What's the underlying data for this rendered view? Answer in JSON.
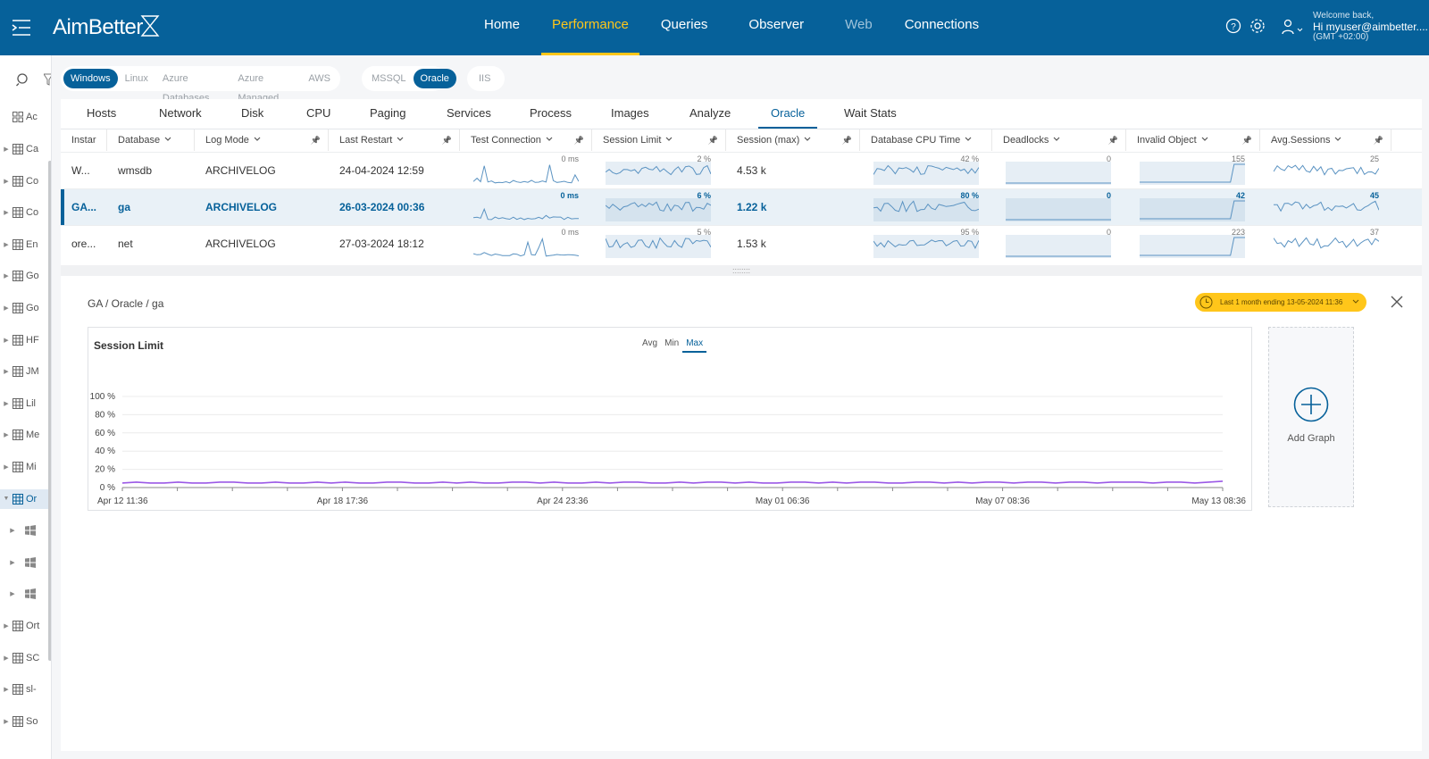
{
  "app": {
    "logo": "AimBetter"
  },
  "nav": {
    "items": [
      {
        "label": "Home",
        "state": "normal"
      },
      {
        "label": "Performance",
        "state": "active"
      },
      {
        "label": "Queries",
        "state": "normal"
      },
      {
        "label": "Observer",
        "state": "normal"
      },
      {
        "label": "Web",
        "state": "dim"
      },
      {
        "label": "Connections",
        "state": "normal"
      }
    ]
  },
  "user": {
    "welcome": "Welcome back,",
    "name": "Hi myuser@aimbetter....",
    "tz": "(GMT +02:00)"
  },
  "rail": {
    "top_label": "Ac",
    "items": [
      "Ca",
      "Co",
      "Co",
      "En",
      "Go",
      "Go",
      "HF",
      "JM",
      "Lil",
      "Me",
      "Mi",
      "Or",
      "",
      "",
      "",
      "Ort",
      "SC",
      "sl-",
      "So"
    ],
    "selected_index": 11
  },
  "filters": {
    "os": [
      "Windows",
      "Linux",
      "Azure Databases",
      "Azure Managed",
      "AWS"
    ],
    "os_active": 0,
    "db": [
      "MSSQL",
      "Oracle"
    ],
    "db_active": 1,
    "web": [
      "IIS"
    ]
  },
  "tabs": [
    "Hosts",
    "Network",
    "Disk",
    "CPU",
    "Paging",
    "Services",
    "Process",
    "Images",
    "Analyze",
    "Oracle",
    "Wait Stats"
  ],
  "tab_active": 9,
  "grid": {
    "columns": [
      "Instar",
      "Database",
      "Log Mode",
      "Last Restart",
      "Test Connection",
      "Session Limit",
      "Session (max)",
      "Database CPU Time",
      "Deadlocks",
      "Invalid Object",
      "Avg.Sessions"
    ],
    "rows": [
      {
        "instance": "W...",
        "database": "wmsdb",
        "logmode": "ARCHIVELOG",
        "restart": "24-04-2024 12:59",
        "test": "0 ms",
        "limit": "2 %",
        "session": "4.53 k",
        "cpu": "42 %",
        "deadlocks": "0",
        "invalid": "155",
        "avg": "25"
      },
      {
        "instance": "GA...",
        "database": "ga",
        "logmode": "ARCHIVELOG",
        "restart": "26-03-2024 00:36",
        "test": "0 ms",
        "limit": "6 %",
        "session": "1.22 k",
        "cpu": "80 %",
        "deadlocks": "0",
        "invalid": "42",
        "avg": "45"
      },
      {
        "instance": "ore...",
        "database": "net",
        "logmode": "ARCHIVELOG",
        "restart": "27-03-2024 18:12",
        "test": "0 ms",
        "limit": "5 %",
        "session": "1.53 k",
        "cpu": "95 %",
        "deadlocks": "0",
        "invalid": "223",
        "avg": "37"
      }
    ],
    "selected_row": 1
  },
  "splitter": "::::::::",
  "detail": {
    "breadcrumb": "GA / Oracle / ga",
    "range": "Last 1 month ending  13-05-2024 11:36",
    "add_graph": "Add Graph",
    "agg": [
      "Avg",
      "Min",
      "Max"
    ],
    "agg_active": 2
  },
  "chart_data": {
    "type": "line",
    "title": "Session Limit",
    "y_ticks": [
      "0 %",
      "20 %",
      "40 %",
      "60 %",
      "80 %",
      "100 %"
    ],
    "ylim": [
      0,
      100
    ],
    "x_ticks": [
      "Apr 12 11:36",
      "Apr 18 17:36",
      "Apr 24 23:36",
      "May 01 06:36",
      "May 07 08:36",
      "May 13 08:36"
    ],
    "series": [
      {
        "values": [
          5,
          6,
          5,
          5,
          6,
          5,
          5,
          6,
          6,
          5,
          5,
          6,
          5,
          5,
          6,
          5,
          6,
          5,
          5,
          6,
          6,
          5,
          5,
          6,
          5,
          6,
          5,
          5,
          6,
          6,
          5,
          6,
          5,
          5,
          6,
          5,
          6,
          6,
          5,
          5,
          6,
          5,
          6,
          6,
          5,
          6,
          5,
          5,
          6,
          6,
          5,
          6,
          5,
          6,
          6,
          5,
          5,
          6,
          6,
          5,
          6,
          5,
          6,
          6,
          5,
          6,
          6,
          5,
          6,
          6,
          5,
          6,
          6,
          6,
          5,
          6,
          6,
          5,
          6,
          7
        ]
      }
    ],
    "color": "#9b59e6",
    "grid": true
  }
}
